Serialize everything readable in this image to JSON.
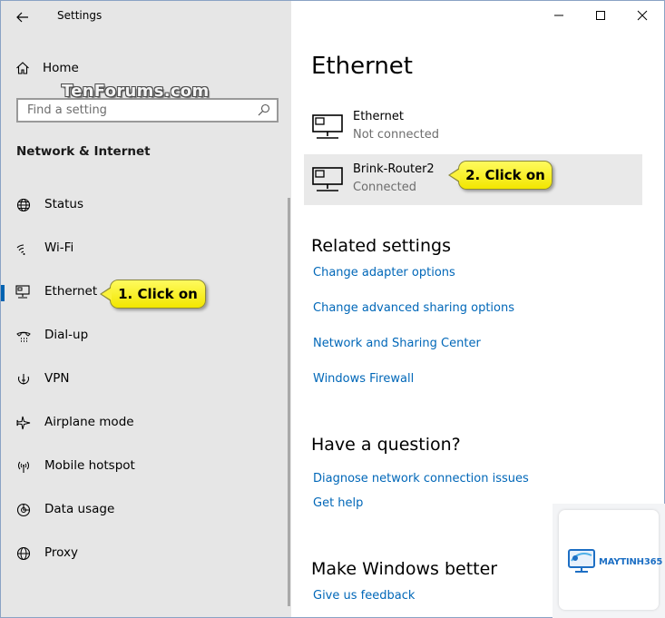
{
  "app": {
    "title": "Settings"
  },
  "sidebar": {
    "home_label": "Home",
    "search_placeholder": "Find a setting",
    "section_title": "Network & Internet",
    "items": [
      {
        "label": "Status",
        "icon": "globe-icon"
      },
      {
        "label": "Wi-Fi",
        "icon": "wifi-icon"
      },
      {
        "label": "Ethernet",
        "icon": "ethernet-icon",
        "selected": true
      },
      {
        "label": "Dial-up",
        "icon": "dialup-icon"
      },
      {
        "label": "VPN",
        "icon": "vpn-icon"
      },
      {
        "label": "Airplane mode",
        "icon": "airplane-icon"
      },
      {
        "label": "Mobile hotspot",
        "icon": "hotspot-icon"
      },
      {
        "label": "Data usage",
        "icon": "data-usage-icon"
      },
      {
        "label": "Proxy",
        "icon": "proxy-globe-icon"
      }
    ]
  },
  "watermark": "TenForums.com",
  "callouts": {
    "step1": "1. Click on",
    "step2": "2. Click on"
  },
  "main": {
    "title": "Ethernet",
    "connections": [
      {
        "name": "Ethernet",
        "status": "Not connected"
      },
      {
        "name": "Brink-Router2",
        "status": "Connected"
      }
    ],
    "related": {
      "heading": "Related settings",
      "links": [
        "Change adapter options",
        "Change advanced sharing options",
        "Network and Sharing Center",
        "Windows Firewall"
      ]
    },
    "question": {
      "heading": "Have a question?",
      "links": [
        "Diagnose network connection issues",
        "Get help"
      ]
    },
    "better": {
      "heading": "Make Windows better",
      "link": "Give us feedback"
    }
  },
  "logo": {
    "text": "MAYTINH365"
  },
  "colors": {
    "sidebar_bg": "#e6e6e6",
    "accent": "#0063b1",
    "link": "#0067b8",
    "callout": "#f8f02a",
    "hover_row": "#e9e9e9"
  }
}
